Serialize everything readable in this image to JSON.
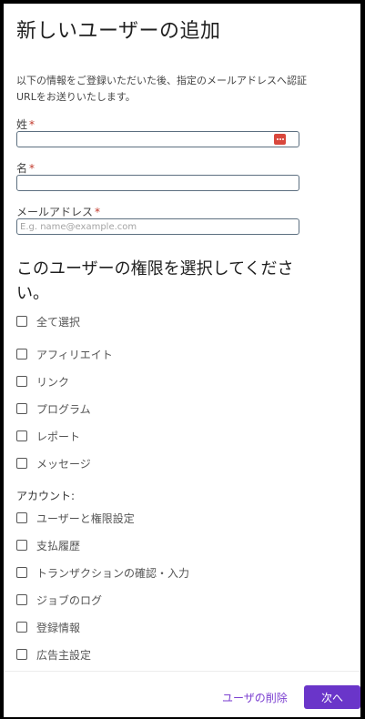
{
  "title": "新しいユーザーの追加",
  "intro": "以下の情報をご登録いただいた後、指定のメールアドレスへ認証URLをお送りいたします。",
  "required_mark": "*",
  "fields": {
    "last_name": {
      "label": "姓",
      "value": "",
      "placeholder": ""
    },
    "first_name": {
      "label": "名",
      "value": "",
      "placeholder": ""
    },
    "email": {
      "label": "メールアドレス",
      "value": "",
      "placeholder": "E.g. name@example.com"
    }
  },
  "permissions": {
    "heading": "このユーザーの権限を選択してください。",
    "select_all": "全て選択",
    "items": [
      {
        "label": "アフィリエイト",
        "checked": false
      },
      {
        "label": "リンク",
        "checked": false
      },
      {
        "label": "プログラム",
        "checked": false
      },
      {
        "label": "レポート",
        "checked": false
      },
      {
        "label": "メッセージ",
        "checked": false
      }
    ],
    "account_group_label": "アカウント:",
    "account_items": [
      {
        "label": "ユーザーと権限設定",
        "checked": false
      },
      {
        "label": "支払履歴",
        "checked": false
      },
      {
        "label": "トランザクションの確認・入力",
        "checked": false
      },
      {
        "label": "ジョブのログ",
        "checked": false
      },
      {
        "label": "登録情報",
        "checked": false
      },
      {
        "label": "広告主設定",
        "checked": false
      }
    ]
  },
  "footer": {
    "delete_label": "ユーザの削除",
    "next_label": "次へ"
  },
  "colors": {
    "accent": "#6a35c9",
    "link": "#7b3fd0",
    "required": "#c0392b",
    "password_manager_icon": "#d9473c"
  },
  "icons": {
    "password_manager": "password-manager-icon"
  }
}
